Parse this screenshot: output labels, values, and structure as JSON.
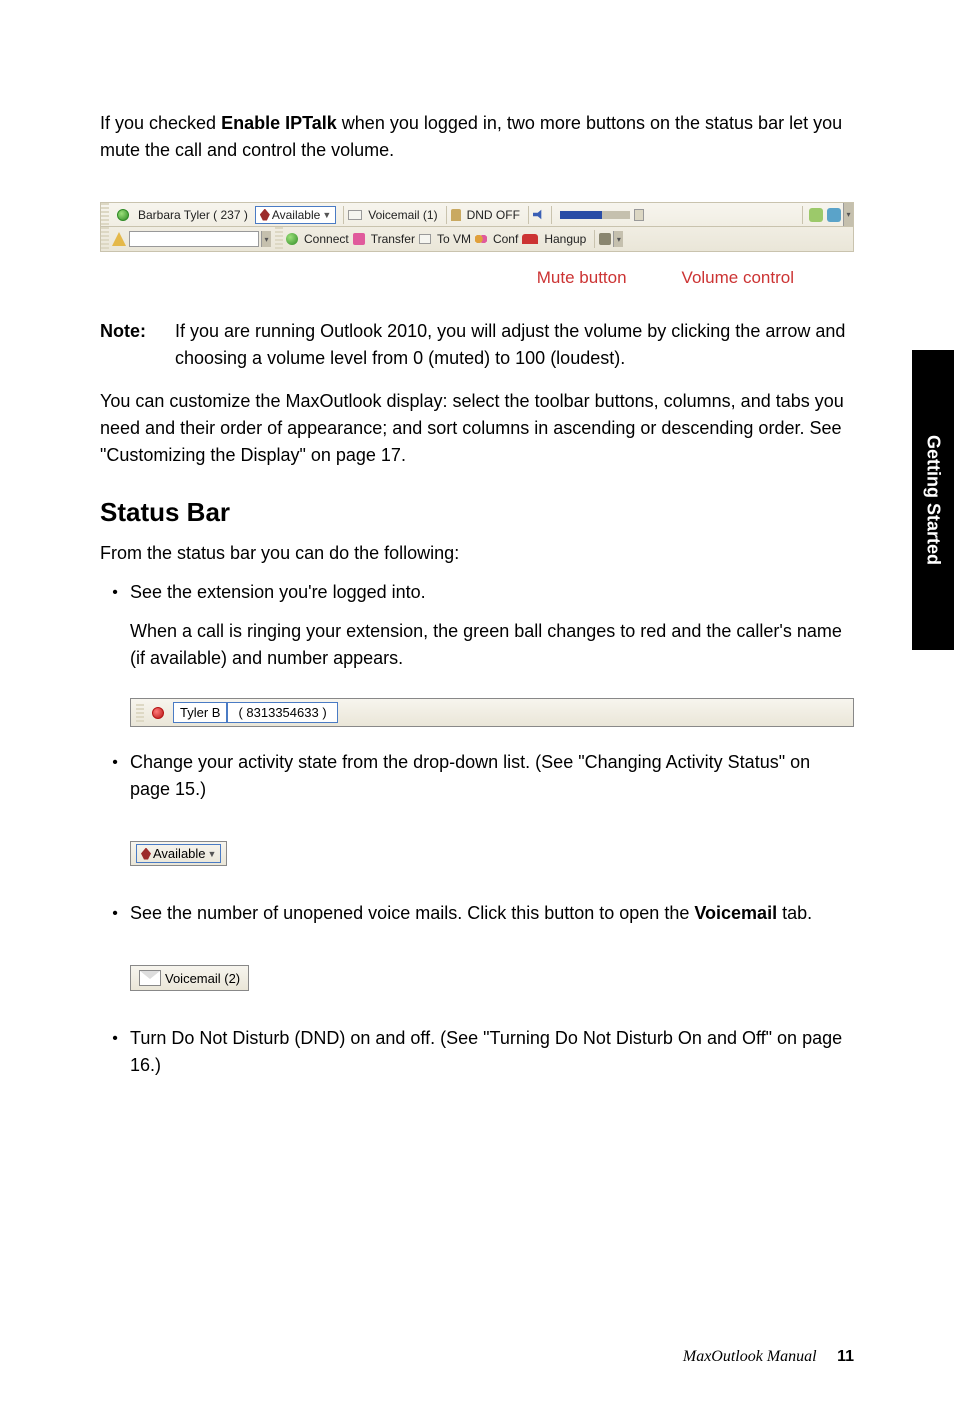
{
  "intro": {
    "prefix": "If you checked ",
    "bold": "Enable IPTalk",
    "suffix": " when you logged in, two more buttons on the status bar let you mute the call and control the volume."
  },
  "toolbar": {
    "ext_label": "Barbara Tyler ( 237 )",
    "available": "Available",
    "voicemail": "Voicemail (1)",
    "dnd": "DND OFF",
    "connect": "Connect",
    "transfer": "Transfer",
    "tovm": "To VM",
    "conf": "Conf",
    "hangup": "Hangup"
  },
  "annot": {
    "mute": "Mute button",
    "vol": "Volume control"
  },
  "note": {
    "label": "Note:",
    "text": "If you are running Outlook 2010, you will adjust the volume by clicking the arrow and choosing a volume level from 0 (muted) to 100 (loudest)."
  },
  "customize": "You can customize the MaxOutlook display: select the toolbar buttons, columns, and tabs you need and their order of appearance; and sort columns in ascending or descending order. See \"Customizing the Display\" on page 17.",
  "statusbar_h": "Status Bar",
  "statusbar_intro": "From the status bar you can do the following:",
  "b1": {
    "l1": "See the extension you're logged into.",
    "l2": "When a call is ringing your extension, the green ball changes to red and the caller's name (if available) and number appears."
  },
  "ext_sample": {
    "name": "Tyler B",
    "num": "( 8313354633 )"
  },
  "b2": "Change your activity state from the drop-down list. (See \"Changing Activity Status\" on page 15.)",
  "avail_sample": "Available",
  "b3": {
    "prefix": "See the number of unopened voice mails. Click this button to open the ",
    "bold": "Voicemail",
    "suffix": " tab."
  },
  "vm_sample": "Voicemail (2)",
  "b4": "Turn Do Not Disturb (DND) on and off. (See \"Turning Do Not Disturb On and Off\" on page 16.)",
  "side_tab": "Getting Started",
  "footer": {
    "title": "MaxOutlook Manual",
    "page": "11"
  },
  "chart_data": null
}
